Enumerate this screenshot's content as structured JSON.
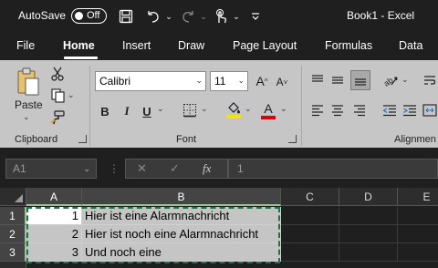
{
  "titlebar": {
    "autosave_label": "AutoSave",
    "autosave_state": "Off",
    "doc_title": "Book1  -  Excel",
    "icons": [
      "save-icon",
      "undo-icon",
      "redo-icon",
      "touch-mode-icon",
      "customize-qat-icon"
    ]
  },
  "ribbon_tabs": [
    "File",
    "Home",
    "Insert",
    "Draw",
    "Page Layout",
    "Formulas",
    "Data"
  ],
  "active_tab": "Home",
  "ribbon": {
    "clipboard": {
      "label": "Clipboard",
      "paste_label": "Paste"
    },
    "font": {
      "label": "Font",
      "font_name": "Calibri",
      "font_size": "11",
      "bold": "B",
      "italic": "I",
      "underline": "U"
    },
    "alignment": {
      "label": "Alignmen"
    }
  },
  "formula_bar": {
    "name_box": "A1",
    "fx_label": "fx",
    "value": "1"
  },
  "sheet": {
    "columns": [
      "A",
      "B",
      "C",
      "D",
      "E"
    ],
    "rows": [
      {
        "num": "1",
        "a": "1",
        "b": "Hier ist eine Alarmnachricht"
      },
      {
        "num": "2",
        "a": "2",
        "b": "Hier ist noch eine Alarmnachricht"
      },
      {
        "num": "3",
        "a": "3",
        "b": "Und noch eine"
      }
    ]
  },
  "colors": {
    "accent_green": "#1f7246",
    "ribbon_bg": "#c7c6c6",
    "dark_bg": "#1f1f1f"
  }
}
